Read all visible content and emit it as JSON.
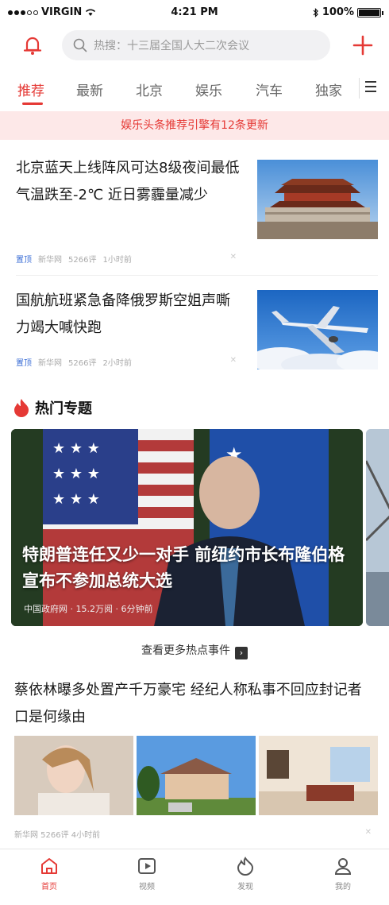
{
  "status_bar": {
    "carrier": "VIRGIN",
    "time": "4:21 PM",
    "battery": "100%"
  },
  "header": {
    "search_placeholder": "热搜：十三届全国人大二次会议"
  },
  "tabs": [
    "推荐",
    "最新",
    "北京",
    "娱乐",
    "汽车",
    "独家"
  ],
  "banner": {
    "text": "娱乐头条推荐引擎有12条更新"
  },
  "news": [
    {
      "title": "北京蓝天上线阵风可达8级夜间最低气温跌至-2℃ 近日雾霾量减少",
      "tag": "置顶",
      "source": "新华网",
      "comments": "5266评",
      "time": "1小时前"
    },
    {
      "title": "国航航班紧急备降俄罗斯空姐声嘶力竭大喊快跑",
      "tag": "置顶",
      "source": "新华网",
      "comments": "5266评",
      "time": "2小时前"
    }
  ],
  "hot": {
    "section_title": "热门专题",
    "card_title": "特朗普连任又少一对手 前纽约市长布隆伯格宣布不参加总统大选",
    "card_meta": "中国政府网 · 15.2万阅 · 6分钟前",
    "more_label": "查看更多热点事件"
  },
  "article3": {
    "title": "蔡依林曝多处置产千万豪宅 经纪人称私事不回应封记者口是何缘由",
    "meta": "新华网 5266评 4小时前"
  },
  "bottom_nav": [
    {
      "label": "首页",
      "icon": "home-icon"
    },
    {
      "label": "视频",
      "icon": "video-icon"
    },
    {
      "label": "发现",
      "icon": "discover-icon"
    },
    {
      "label": "我的",
      "icon": "profile-icon"
    }
  ],
  "colors": {
    "accent": "#e53935",
    "banner_bg": "#fde8e8",
    "tag_blue": "#3d6fd6"
  }
}
